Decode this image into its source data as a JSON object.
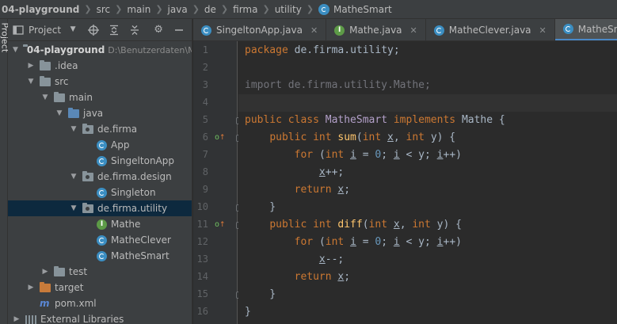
{
  "breadcrumb": [
    "04-playground",
    "src",
    "main",
    "java",
    "de",
    "firma",
    "utility",
    "MatheSmart"
  ],
  "tool_strip": {
    "label": "Project"
  },
  "project_panel": {
    "title": "Project",
    "tree": [
      {
        "label": "04-playground",
        "path": "D:\\Benutzerdaten\\M",
        "icon": "module-folder-icon",
        "depth": 0,
        "expanded": true
      },
      {
        "label": ".idea",
        "icon": "folder-icon",
        "depth": 1,
        "expanded": false
      },
      {
        "label": "src",
        "icon": "folder-icon",
        "depth": 1,
        "expanded": true
      },
      {
        "label": "main",
        "icon": "folder-icon",
        "depth": 2,
        "expanded": true
      },
      {
        "label": "java",
        "icon": "source-folder-icon",
        "depth": 3,
        "expanded": true
      },
      {
        "label": "de.firma",
        "icon": "package-icon",
        "depth": 4,
        "expanded": true
      },
      {
        "label": "App",
        "icon": "class-icon",
        "depth": 5
      },
      {
        "label": "SingeltonApp",
        "icon": "class-icon",
        "depth": 5
      },
      {
        "label": "de.firma.design",
        "icon": "package-icon",
        "depth": 4,
        "expanded": true
      },
      {
        "label": "Singleton",
        "icon": "class-icon",
        "depth": 5
      },
      {
        "label": "de.firma.utility",
        "icon": "package-icon",
        "depth": 4,
        "expanded": true,
        "selected": true
      },
      {
        "label": "Mathe",
        "icon": "interface-icon",
        "depth": 5
      },
      {
        "label": "MatheClever",
        "icon": "class-icon",
        "depth": 5
      },
      {
        "label": "MatheSmart",
        "icon": "class-icon",
        "depth": 5
      },
      {
        "label": "test",
        "icon": "folder-icon",
        "depth": 2,
        "expanded": false
      },
      {
        "label": "target",
        "icon": "excluded-folder-icon",
        "depth": 1,
        "expanded": false
      },
      {
        "label": "pom.xml",
        "icon": "maven-icon",
        "depth": 1
      },
      {
        "label": "External Libraries",
        "icon": "libraries-icon",
        "depth": 0,
        "expanded": false
      }
    ]
  },
  "tabs": [
    {
      "label": "SingeltonApp.java",
      "icon": "class-icon",
      "active": false
    },
    {
      "label": "Mathe.java",
      "icon": "interface-icon",
      "active": false
    },
    {
      "label": "MatheClever.java",
      "icon": "class-icon",
      "active": false
    },
    {
      "label": "MatheSmart.java",
      "icon": "class-icon",
      "active": true
    }
  ],
  "editor": {
    "current_line": 4,
    "lines": [
      {
        "n": "1",
        "tokens": [
          [
            "kw",
            "package "
          ],
          [
            "",
            "de.firma.utility;"
          ]
        ]
      },
      {
        "n": "2",
        "tokens": []
      },
      {
        "n": "3",
        "tokens": [
          [
            "gray",
            "import de.firma.utility.Mathe;"
          ]
        ]
      },
      {
        "n": "4",
        "tokens": []
      },
      {
        "n": "5",
        "tokens": [
          [
            "kw",
            "public class "
          ],
          [
            "cls",
            "MatheSmart "
          ],
          [
            "kw",
            "implements "
          ],
          [
            "",
            "Mathe {"
          ]
        ]
      },
      {
        "n": "6",
        "tokens": [
          [
            "",
            "    "
          ],
          [
            "kw",
            "public int "
          ],
          [
            "fn",
            "sum"
          ],
          [
            "",
            "("
          ],
          [
            "kw",
            "int "
          ],
          [
            "ul",
            "x"
          ],
          [
            "",
            ", "
          ],
          [
            "kw",
            "int "
          ],
          [
            "",
            "y) {"
          ]
        ]
      },
      {
        "n": "7",
        "tokens": [
          [
            "",
            "        "
          ],
          [
            "kw",
            "for "
          ],
          [
            "",
            "("
          ],
          [
            "kw",
            "int "
          ],
          [
            "ul",
            "i"
          ],
          [
            "",
            " = "
          ],
          [
            "num",
            "0"
          ],
          [
            "",
            "; "
          ],
          [
            "ul",
            "i"
          ],
          [
            "",
            " < y; "
          ],
          [
            "ul",
            "i"
          ],
          [
            "",
            "++)"
          ]
        ]
      },
      {
        "n": "8",
        "tokens": [
          [
            "",
            "            "
          ],
          [
            "ul",
            "x"
          ],
          [
            "",
            "++;"
          ]
        ]
      },
      {
        "n": "9",
        "tokens": [
          [
            "",
            "        "
          ],
          [
            "kw",
            "return "
          ],
          [
            "ul",
            "x"
          ],
          [
            "",
            ";"
          ]
        ]
      },
      {
        "n": "10",
        "tokens": [
          [
            "",
            "    }"
          ]
        ]
      },
      {
        "n": "11",
        "tokens": [
          [
            "",
            "    "
          ],
          [
            "kw",
            "public int "
          ],
          [
            "fn",
            "diff"
          ],
          [
            "",
            "("
          ],
          [
            "kw",
            "int "
          ],
          [
            "ul",
            "x"
          ],
          [
            "",
            ", "
          ],
          [
            "kw",
            "int "
          ],
          [
            "",
            "y) {"
          ]
        ]
      },
      {
        "n": "12",
        "tokens": [
          [
            "",
            "        "
          ],
          [
            "kw",
            "for "
          ],
          [
            "",
            "("
          ],
          [
            "kw",
            "int "
          ],
          [
            "ul",
            "i"
          ],
          [
            "",
            " = "
          ],
          [
            "num",
            "0"
          ],
          [
            "",
            "; "
          ],
          [
            "ul",
            "i"
          ],
          [
            "",
            " < y; "
          ],
          [
            "ul",
            "i"
          ],
          [
            "",
            "++)"
          ]
        ]
      },
      {
        "n": "13",
        "tokens": [
          [
            "",
            "            "
          ],
          [
            "ul",
            "x"
          ],
          [
            "",
            "--;"
          ]
        ]
      },
      {
        "n": "14",
        "tokens": [
          [
            "",
            "        "
          ],
          [
            "kw",
            "return "
          ],
          [
            "ul",
            "x"
          ],
          [
            "",
            ";"
          ]
        ]
      },
      {
        "n": "15",
        "tokens": [
          [
            "",
            "    }"
          ]
        ]
      },
      {
        "n": "16",
        "tokens": [
          [
            "",
            "}"
          ]
        ]
      }
    ],
    "gutter_marks": [
      {
        "line": 5,
        "type": "fold"
      },
      {
        "line": 6,
        "type": "implements-override",
        "fold": true
      },
      {
        "line": 10,
        "type": "fold"
      },
      {
        "line": 11,
        "type": "implements-override",
        "fold": true
      },
      {
        "line": 15,
        "type": "fold"
      }
    ]
  },
  "colors": {
    "keyword": "#cc7832",
    "function": "#ffc66d",
    "number": "#6897bb",
    "class_icon": "#3b8ec2",
    "interface_icon": "#5d9b47",
    "selection": "#0d293e",
    "active_tab_underline": "#4a88c7"
  }
}
